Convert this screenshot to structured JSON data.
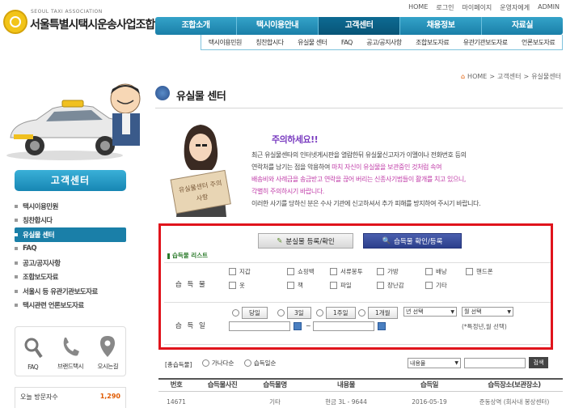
{
  "header": {
    "logo_small": "SEOUL TAXI ASSOCIATION",
    "logo_title": "서울특별시택시운송사업조합",
    "top_links": [
      "HOME",
      "로그인",
      "마이페이지",
      "운영자에게",
      "ADMIN"
    ],
    "main_tabs": [
      "조합소개",
      "택시이용안내",
      "고객센터",
      "채용정보",
      "자료실"
    ],
    "active_tab": "고객센터",
    "sub_tabs": [
      "택시이용민원",
      "칭찬합시다",
      "유실물 센터",
      "FAQ",
      "공고/공지사항",
      "조합보도자료",
      "유관기관보도자료",
      "언론보도자료"
    ]
  },
  "sidebar": {
    "title": "고객센터",
    "items": [
      {
        "label": "택시이용민원",
        "active": false
      },
      {
        "label": "칭찬합시다",
        "active": false
      },
      {
        "label": "유실물 센터",
        "active": true
      },
      {
        "label": "FAQ",
        "active": false
      },
      {
        "label": "공고/공지사항",
        "active": false
      },
      {
        "label": "조합보도자료",
        "active": false
      },
      {
        "label": "서울시 등 유관기관보도자료",
        "active": false
      },
      {
        "label": "택시관련 언론보도자료",
        "active": false
      }
    ],
    "quick": [
      "FAQ",
      "브랜드택시",
      "오시는길"
    ],
    "visit_label": "오늘 방문자수",
    "visit_count": "1,290"
  },
  "content": {
    "breadcrumb": [
      "HOME",
      "고객센터",
      "유실물센터"
    ],
    "page_title": "유실물 센터",
    "warn_title": "주의하세요!!",
    "warn_line1": "최근 유실물센타의 인터넷게시판을 열람한뒤 유실물신고자가 이멜이나 전화번호 등의",
    "warn_line2a": "연락처를 남기는 점을 악용하여 ",
    "warn_line2b": "마치 자신이 유실물을 보관중인 것처럼 속여",
    "warn_line3": "배송비와 사례금을 송금받고 연락을 끊어 버리는 신종사기범들이 활개를 치고 있으니,",
    "warn_line4": "각별히 주의하시기 바랍니다.",
    "warn_line5": "이러한 사기를 당하신 분은 수사 기관에 신고하셔서 추가 피해를 방지하여 주시기 바랍니다.",
    "sign_text": "유실물센터 주의사항",
    "reg_button": "분실물 등록/확인",
    "confirm_button": "습득물 확인/등록",
    "list_label": "습득물 리스트",
    "item_label": "습 득 물",
    "items": [
      "지갑",
      "쇼핑백",
      "서류봉투",
      "가방",
      "배낭",
      "핸드폰",
      "옷",
      "책",
      "파일",
      "장난감",
      "기타"
    ],
    "date_label": "습 득 일",
    "periods": [
      "당일",
      "3일",
      "1주일",
      "1개월"
    ],
    "year_select": "년 선택",
    "month_select": "월 선택",
    "date_tilde": "~",
    "date_note": "(*특정년,월 선택)",
    "bottom_label": "[총습득물]",
    "radio_a": "가나다순",
    "radio_b": "습득일순",
    "filter_select": "내용물",
    "search_button": "검색",
    "table_headers": [
      "번호",
      "습득물사진",
      "습득물명",
      "내용물",
      "습득일",
      "습득장소(보관장소)"
    ],
    "table_row": [
      "14671",
      "",
      "기타",
      "현금 3L - 9644",
      "2016-05-19",
      "준동상역 (회사내 봉상센터)"
    ]
  },
  "colors": {
    "nav_blue": "#1a7fa8",
    "warn_purple": "#7a3cc0",
    "highlight_red": "#e0141c",
    "visit_orange": "#e05a00"
  }
}
